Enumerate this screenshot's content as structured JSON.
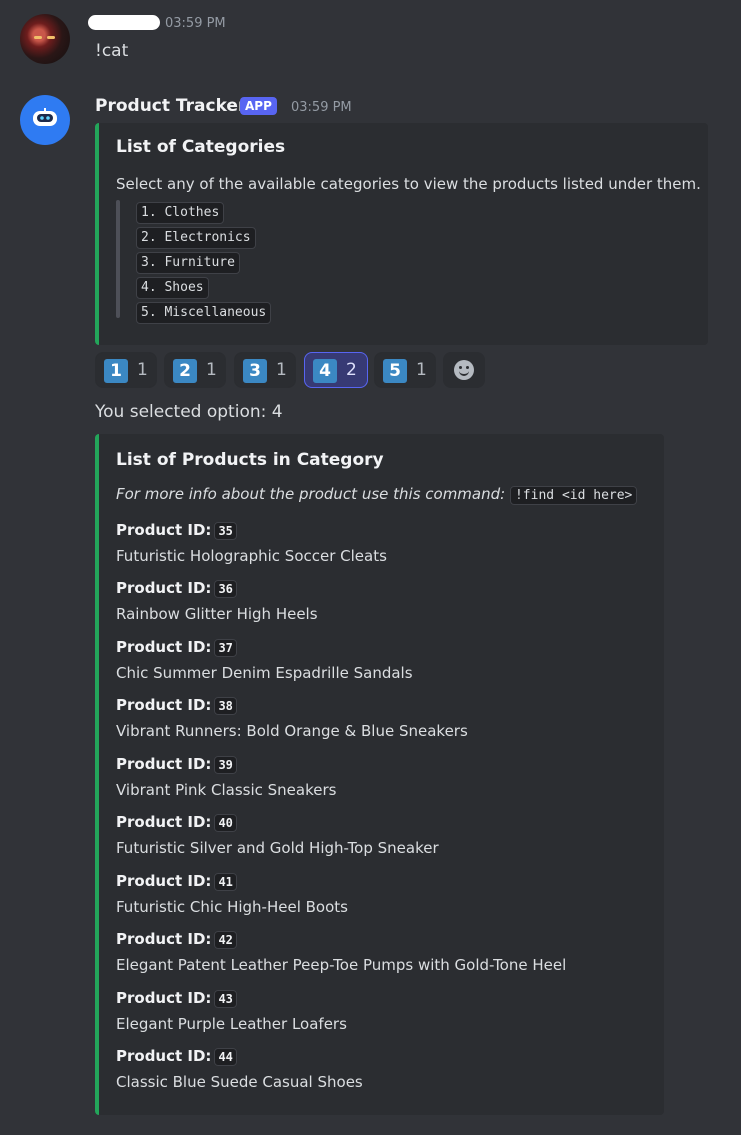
{
  "user_message": {
    "timestamp": "03:59 PM",
    "text": "!cat"
  },
  "bot_message": {
    "name": "Product Tracker",
    "badge": "APP",
    "timestamp": "03:59 PM",
    "categories_embed": {
      "title": "List of Categories",
      "description": "Select any of the available categories to view the products listed under them.",
      "items": [
        "1. Clothes",
        "2. Electronics",
        "3. Furniture",
        "4. Shoes",
        "5. Miscellaneous"
      ],
      "accent": "#23a55a"
    },
    "reactions": [
      {
        "emoji": "1",
        "count": "1",
        "active": false
      },
      {
        "emoji": "2",
        "count": "1",
        "active": false
      },
      {
        "emoji": "3",
        "count": "1",
        "active": false
      },
      {
        "emoji": "4",
        "count": "2",
        "active": true
      },
      {
        "emoji": "5",
        "count": "1",
        "active": false
      }
    ],
    "add_reaction_icon": "smile-icon",
    "selected_text": "You selected option: 4",
    "products_embed": {
      "title": "List of Products in Category",
      "info_text": "For more info about the product use this command:",
      "command": "!find <id here>",
      "id_label": "Product ID:",
      "products": [
        {
          "id": "35",
          "name": "Futuristic Holographic Soccer Cleats"
        },
        {
          "id": "36",
          "name": "Rainbow Glitter High Heels"
        },
        {
          "id": "37",
          "name": "Chic Summer Denim Espadrille Sandals"
        },
        {
          "id": "38",
          "name": "Vibrant Runners: Bold Orange & Blue Sneakers"
        },
        {
          "id": "39",
          "name": "Vibrant Pink Classic Sneakers"
        },
        {
          "id": "40",
          "name": "Futuristic Silver and Gold High-Top Sneaker"
        },
        {
          "id": "41",
          "name": "Futuristic Chic High-Heel Boots"
        },
        {
          "id": "42",
          "name": "Elegant Patent Leather Peep-Toe Pumps with Gold-Tone Heel"
        },
        {
          "id": "43",
          "name": "Elegant Purple Leather Loafers"
        },
        {
          "id": "44",
          "name": "Classic Blue Suede Casual Shoes"
        }
      ],
      "accent": "#23a55a"
    }
  }
}
